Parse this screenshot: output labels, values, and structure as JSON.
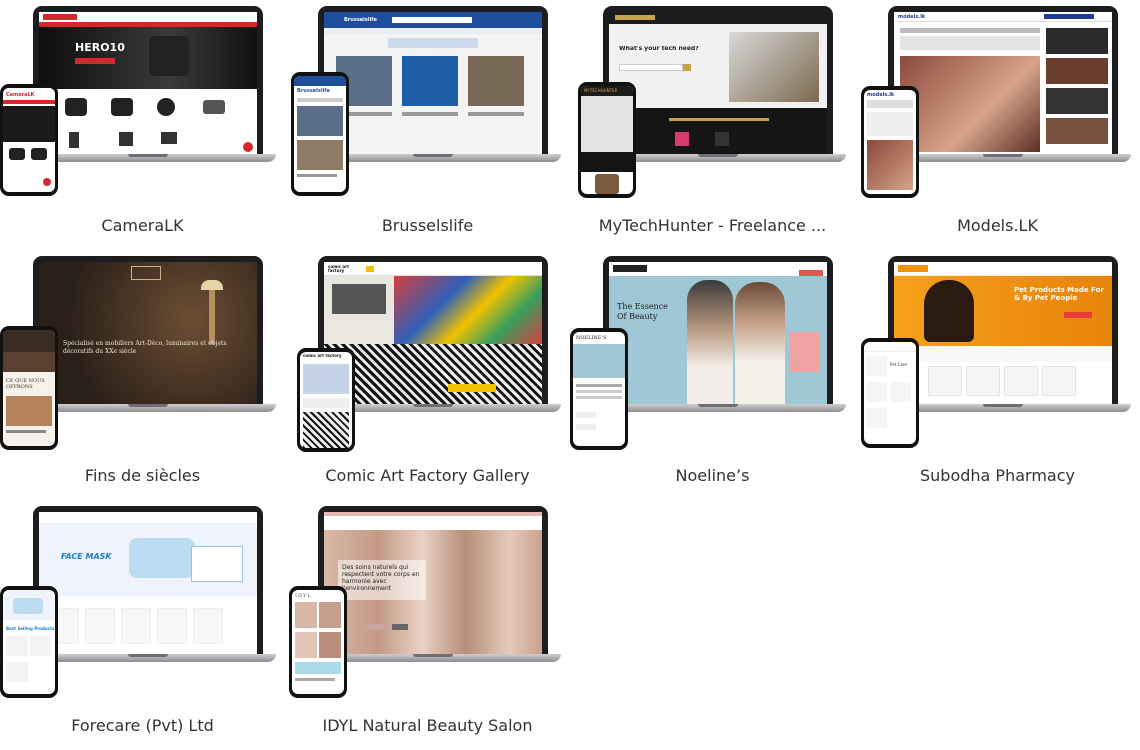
{
  "projects": [
    {
      "caption": "CameraLK",
      "screen_text": "HERO10",
      "phone_text": "CameraLK",
      "accent": "#d8262c"
    },
    {
      "caption": "Brusselslife",
      "screen_text": "Brusselslife",
      "phone_text": "Brusselslife",
      "accent": "#1d4f9c"
    },
    {
      "caption": "MyTechHunter - Freelance ...",
      "screen_text": "What's your tech need?",
      "phone_text": "MYTECHHUNTER",
      "accent": "#c8a24a"
    },
    {
      "caption": "Models.LK",
      "screen_text": "models.lk",
      "phone_text": "models.lk",
      "accent": "#1f3a93"
    },
    {
      "caption": "Fins de siècles",
      "screen_text": "Spécialisé en mobiliers Art-Déco, luminaires et objets décoratifs du XXe siècle",
      "phone_text": "CE QUE NOUS OFFRONS",
      "accent": "#3a2c22"
    },
    {
      "caption": "Comic Art Factory Gallery",
      "screen_text": "comic art factory",
      "phone_text": "comic art factory",
      "accent": "#f2c200"
    },
    {
      "caption": "Noeline’s",
      "screen_text": "The Essence Of Beauty",
      "phone_text": "NOELINE'S",
      "accent": "#9fc8d6"
    },
    {
      "caption": "Subodha Pharmacy",
      "screen_text": "Pet Products Made For & By Pet People",
      "phone_text": "Pet Care",
      "accent": "#f39200"
    },
    {
      "caption": "Forecare (Pvt) Ltd",
      "screen_text": "FACE MASK",
      "phone_text": "Best Selling Products",
      "accent": "#1e7ec8"
    },
    {
      "caption": "IDYL Natural Beauty Salon",
      "screen_text": "Des soins naturels qui respectent votre corps en harmonie avec l'environnement",
      "phone_text": "IDYL",
      "accent": "#c9a7a0"
    }
  ]
}
